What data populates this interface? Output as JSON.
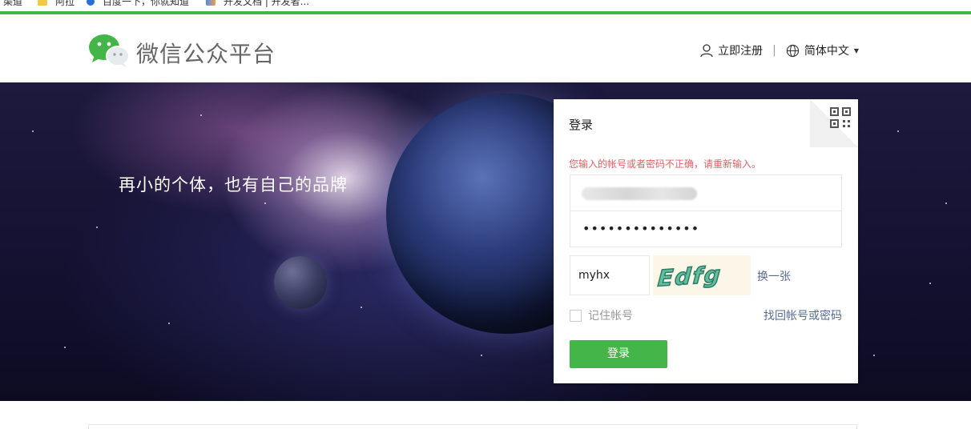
{
  "bookmarks": [
    {
      "label": "渠道",
      "icon": "none"
    },
    {
      "label": "阿拉",
      "icon": "folder-icon"
    },
    {
      "label": "百度一下，你就知道",
      "icon": "baidu-icon"
    },
    {
      "label": "开发文档 | 开发者...",
      "icon": "docs-icon"
    }
  ],
  "header": {
    "brand": "微信公众平台",
    "register": "立即注册",
    "separator": "|",
    "language": "简体中文"
  },
  "banner": {
    "slogan": "再小的个体，也有自己的品牌"
  },
  "login": {
    "title": "登录",
    "error": "您输入的帐号或者密码不正确，请重新输入。",
    "password_masked": "••••••••••••••",
    "captcha_value": "myhx",
    "captcha_text": "Edfg",
    "change_captcha": "换一张",
    "remember": "记住帐号",
    "forgot": "找回帐号或密码",
    "submit": "登录"
  },
  "colors": {
    "accent": "#44b549",
    "error": "#e15f63",
    "link": "#576b95"
  }
}
